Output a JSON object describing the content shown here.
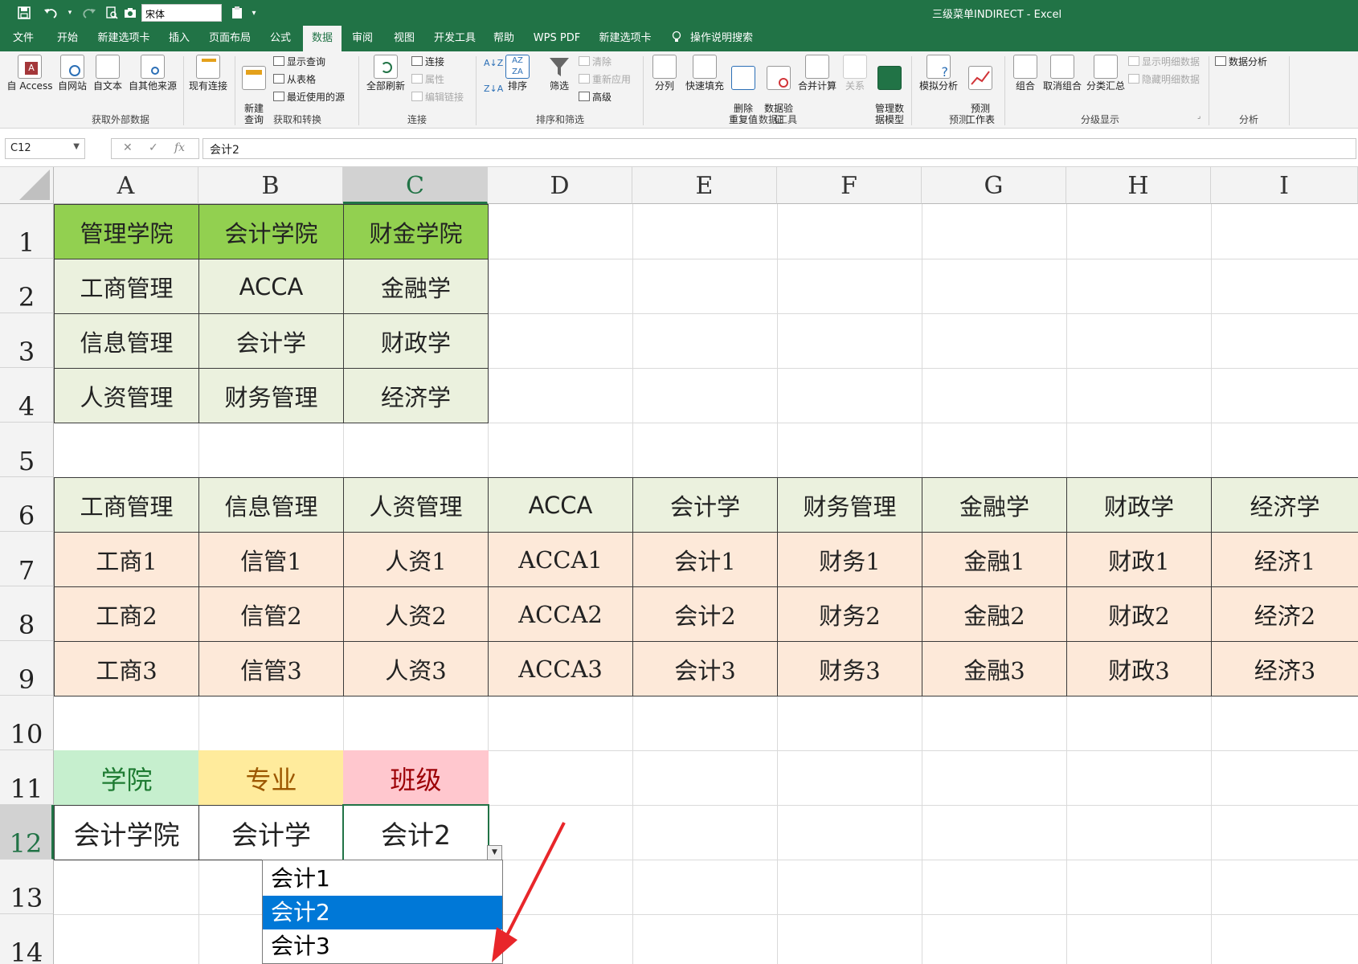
{
  "titlebar": {
    "font_name": "宋体",
    "window_title": "三级菜单INDIRECT  -  Excel"
  },
  "tabs": [
    "文件",
    "开始",
    "新建选项卡",
    "插入",
    "页面布局",
    "公式",
    "数据",
    "审阅",
    "视图",
    "开发工具",
    "帮助",
    "WPS PDF",
    "新建选项卡",
    "操作说明搜索"
  ],
  "active_tab": "数据",
  "ribbon": {
    "get_external": {
      "label": "获取外部数据",
      "buttons": [
        "自 Access",
        "自网站",
        "自文本",
        "自其他来源",
        "现有连接"
      ]
    },
    "get_transform": {
      "label": "获取和转换",
      "new_query": "新建\n查询",
      "small": [
        "显示查询",
        "从表格",
        "最近使用的源"
      ]
    },
    "connections": {
      "label": "连接",
      "refresh_all": "全部刷新",
      "small": [
        "连接",
        "属性",
        "编辑链接"
      ]
    },
    "sort_filter": {
      "label": "排序和筛选",
      "sort": "排序",
      "filter": "筛选",
      "small": [
        "清除",
        "重新应用",
        "高级"
      ]
    },
    "data_tools": {
      "label": "数据工具",
      "buttons": [
        "分列",
        "快速填充",
        "删除\n重复值",
        "数据验\n证",
        "合并计算",
        "关系",
        "管理数\n据模型"
      ]
    },
    "forecast": {
      "label": "预测",
      "buttons": [
        "模拟分析",
        "预测\n工作表"
      ]
    },
    "outline": {
      "label": "分级显示",
      "buttons": [
        "组合",
        "取消组合",
        "分类汇总"
      ],
      "small": [
        "显示明细数据",
        "隐藏明细数据"
      ]
    },
    "analysis": {
      "label": "分析",
      "small": [
        "数据分析"
      ]
    }
  },
  "formula_bar": {
    "name_box": "C12",
    "content": "会计2"
  },
  "columns": [
    "A",
    "B",
    "C",
    "D",
    "E",
    "F",
    "G",
    "H",
    "I"
  ],
  "selected_column": "C",
  "rows": [
    "1",
    "2",
    "3",
    "4",
    "5",
    "6",
    "7",
    "8",
    "9",
    "10",
    "11",
    "12",
    "13",
    "14"
  ],
  "selected_row": "12",
  "sheet": {
    "colleges": [
      "管理学院",
      "会计学院",
      "财金学院"
    ],
    "majors_table": [
      [
        "工商管理",
        "ACCA",
        "金融学"
      ],
      [
        "信息管理",
        "会计学",
        "财政学"
      ],
      [
        "人资管理",
        "财务管理",
        "经济学"
      ]
    ],
    "majors_header": [
      "工商管理",
      "信息管理",
      "人资管理",
      "ACCA",
      "会计学",
      "财务管理",
      "金融学",
      "财政学",
      "经济学"
    ],
    "classes_table": [
      [
        "工商1",
        "信管1",
        "人资1",
        "ACCA1",
        "会计1",
        "财务1",
        "金融1",
        "财政1",
        "经济1"
      ],
      [
        "工商2",
        "信管2",
        "人资2",
        "ACCA2",
        "会计2",
        "财务2",
        "金融2",
        "财政2",
        "经济2"
      ],
      [
        "工商3",
        "信管3",
        "人资3",
        "ACCA3",
        "会计3",
        "财务3",
        "金融3",
        "财政3",
        "经济3"
      ]
    ],
    "selector_labels": [
      "学院",
      "专业",
      "班级"
    ],
    "selector_values": [
      "会计学院",
      "会计学",
      "会计2"
    ]
  },
  "dropdown": {
    "options": [
      "会计1",
      "会计2",
      "会计3"
    ],
    "selected": "会计2"
  },
  "colors": {
    "excel_green": "#217346",
    "college_header": "#92d050",
    "major_fill": "#ebf1de",
    "class_fill": "#fde9d9",
    "label_college_fill": "#c6efce",
    "label_college_text": "#1e7b32",
    "label_major_fill": "#ffeb9c",
    "label_major_text": "#9c5700",
    "label_class_fill": "#ffc7ce",
    "label_class_text": "#9c0006",
    "dropdown_selected": "#0078d7",
    "annotation_arrow": "#e8262a"
  }
}
